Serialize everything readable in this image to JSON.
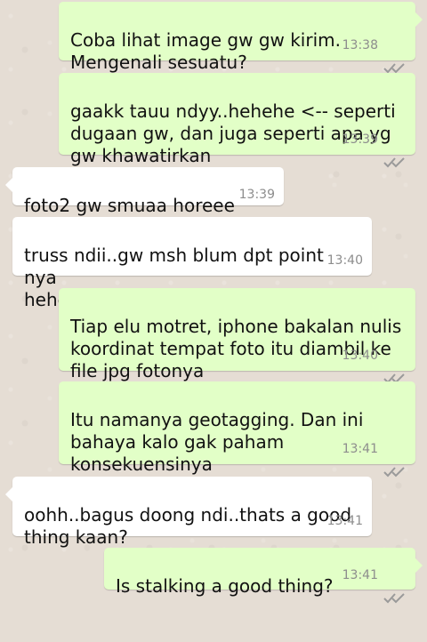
{
  "chat": {
    "messages": [
      {
        "direction": "outgoing",
        "text": "Coba lihat image gw gw kirim.\nMengenali sesuatu?",
        "time": "13:38",
        "status_icon": "double-check-icon"
      },
      {
        "direction": "outgoing",
        "text": "gaakk tauu ndyy..hehehe <-- seperti\ndugaan gw, dan juga seperti apa yg\ngw khawatirkan",
        "time": "13:39",
        "status_icon": "double-check-icon"
      },
      {
        "direction": "incoming",
        "text": "foto2 gw smuaa horeee",
        "time": "13:39"
      },
      {
        "direction": "incoming",
        "text": "truss ndii..gw msh blum dpt point nya\nhehehehe",
        "time": "13:40"
      },
      {
        "direction": "outgoing",
        "text": "Tiap elu motret, iphone bakalan nulis\nkoordinat tempat foto itu diambil ke\nfile jpg fotonya",
        "time": "13:40",
        "status_icon": "double-check-icon"
      },
      {
        "direction": "outgoing",
        "text": "Itu namanya geotagging. Dan ini\nbahaya kalo gak paham\nkonsekuensinya",
        "time": "13:41",
        "status_icon": "double-check-icon"
      },
      {
        "direction": "incoming",
        "text": "oohh..bagus doong ndi..thats a good\nthing kaan?",
        "time": "13:41"
      },
      {
        "direction": "outgoing",
        "text": "Is stalking a good thing?",
        "time": "13:41",
        "status_icon": "double-check-icon"
      }
    ]
  },
  "colors": {
    "background": "#e5ddd4",
    "outgoing_bubble": "#e2ffc7",
    "incoming_bubble": "#ffffff",
    "timestamp": "#8d8d8d"
  }
}
